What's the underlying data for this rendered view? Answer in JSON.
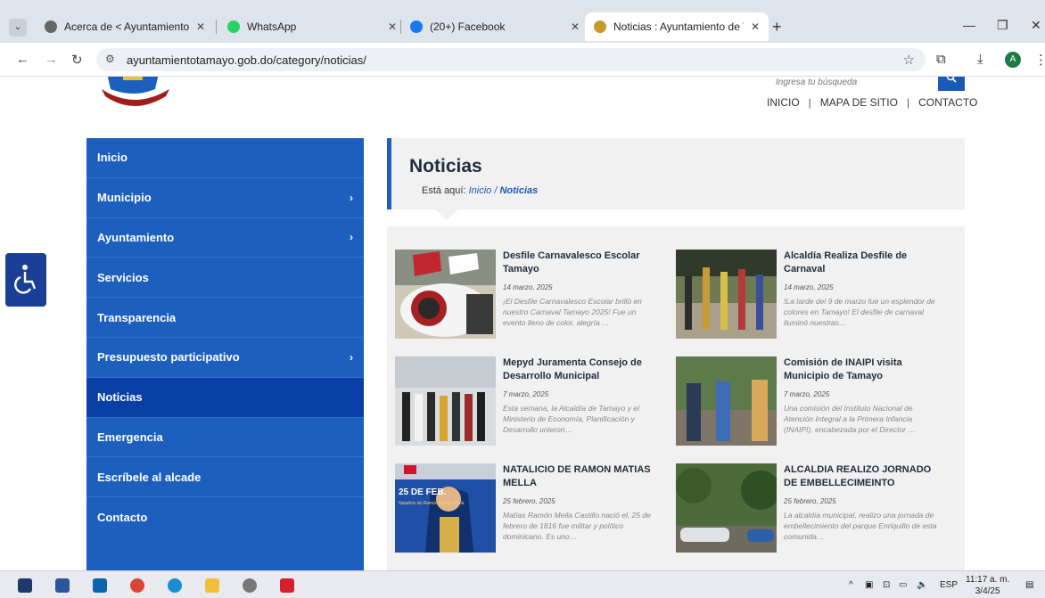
{
  "browser": {
    "tabs": [
      {
        "title": "Acerca de < Ayuntamiento de T",
        "active": false
      },
      {
        "title": "WhatsApp",
        "active": false
      },
      {
        "title": "(20+) Facebook",
        "active": false
      },
      {
        "title": "Noticias : Ayuntamiento de Tam",
        "active": true
      }
    ],
    "new_tab": "+",
    "url": "ayuntamientotamayo.gob.do/category/noticias/",
    "profile_initial": "A"
  },
  "header": {
    "search_placeholder": "Ingresa tu búsqueda",
    "nav": [
      "INICIO",
      "MAPA DE SITIO",
      "CONTACTO"
    ]
  },
  "sidebar": {
    "items": [
      {
        "label": "Inicio",
        "chevron": false,
        "active": false
      },
      {
        "label": "Municipio",
        "chevron": true,
        "active": false
      },
      {
        "label": "Ayuntamiento",
        "chevron": true,
        "active": false
      },
      {
        "label": "Servicios",
        "chevron": false,
        "active": false
      },
      {
        "label": "Transparencia",
        "chevron": false,
        "active": false
      },
      {
        "label": "Presupuesto participativo",
        "chevron": true,
        "active": false
      },
      {
        "label": "Noticias",
        "chevron": false,
        "active": true
      },
      {
        "label": "Emergencia",
        "chevron": false,
        "active": false
      },
      {
        "label": "Escríbele al alcade",
        "chevron": false,
        "active": false
      },
      {
        "label": "Contacto",
        "chevron": false,
        "active": false
      }
    ]
  },
  "main": {
    "title": "Noticias",
    "breadcrumb": {
      "prefix": "Está aquí:",
      "home": "Inicio",
      "sep": "/",
      "current": "Noticias"
    },
    "news": [
      {
        "title": "Desfile Carnavalesco Escolar Tamayo",
        "date": "14 marzo, 2025",
        "excerpt": "¡El Desfile Carnavalesco Escolar brilló en nuestro Carnaval Tamayo 2025! Fue un evento lleno de color, alegría …"
      },
      {
        "title": "Alcaldía Realiza Desfile de Carnaval",
        "date": "14 marzo, 2025",
        "excerpt": "!La tarde del 9 de marzo fue un esplendor de colores en Tamayo! El desfile de carnaval iluminó nuestras…"
      },
      {
        "title": "Mepyd Juramenta Consejo de Desarrollo Municipal",
        "date": "7 marzo, 2025",
        "excerpt": "Esta semana, la Alcaldía de Tamayo y el Ministerio de Economía, Planificación y Desarrollo unieron…"
      },
      {
        "title": "Comisión de INAIPI visita Municipio de Tamayo",
        "date": "7 marzo, 2025",
        "excerpt": "Una comisión del Instituto Nacional de Atención Integral a la Primera Infancia (INAIPI), encabezada por el Director …"
      },
      {
        "title": "NATALICIO DE RAMON MATIAS MELLA",
        "date": "25 febrero, 2025",
        "excerpt": "Matías Ramón Mella Castillo nació el, 25 de febrero de 1816 fue militar y político dominicano. Es uno…",
        "thumb_text_1": "25 DE FEB.",
        "thumb_text_2": "Natalicio de Ramón Matías Mella"
      },
      {
        "title": "ALCALDIA REALIZO JORNADO DE EMBELLECIMEINTO",
        "date": "25 febrero, 2025",
        "excerpt": "La alcaldía municipal, realizo una jornada de embellecimiento del parque Enriquillo de esta comunida…"
      }
    ]
  },
  "taskbar": {
    "lang": "ESP",
    "time": "11:17 a. m.",
    "date": "3/4/25"
  }
}
